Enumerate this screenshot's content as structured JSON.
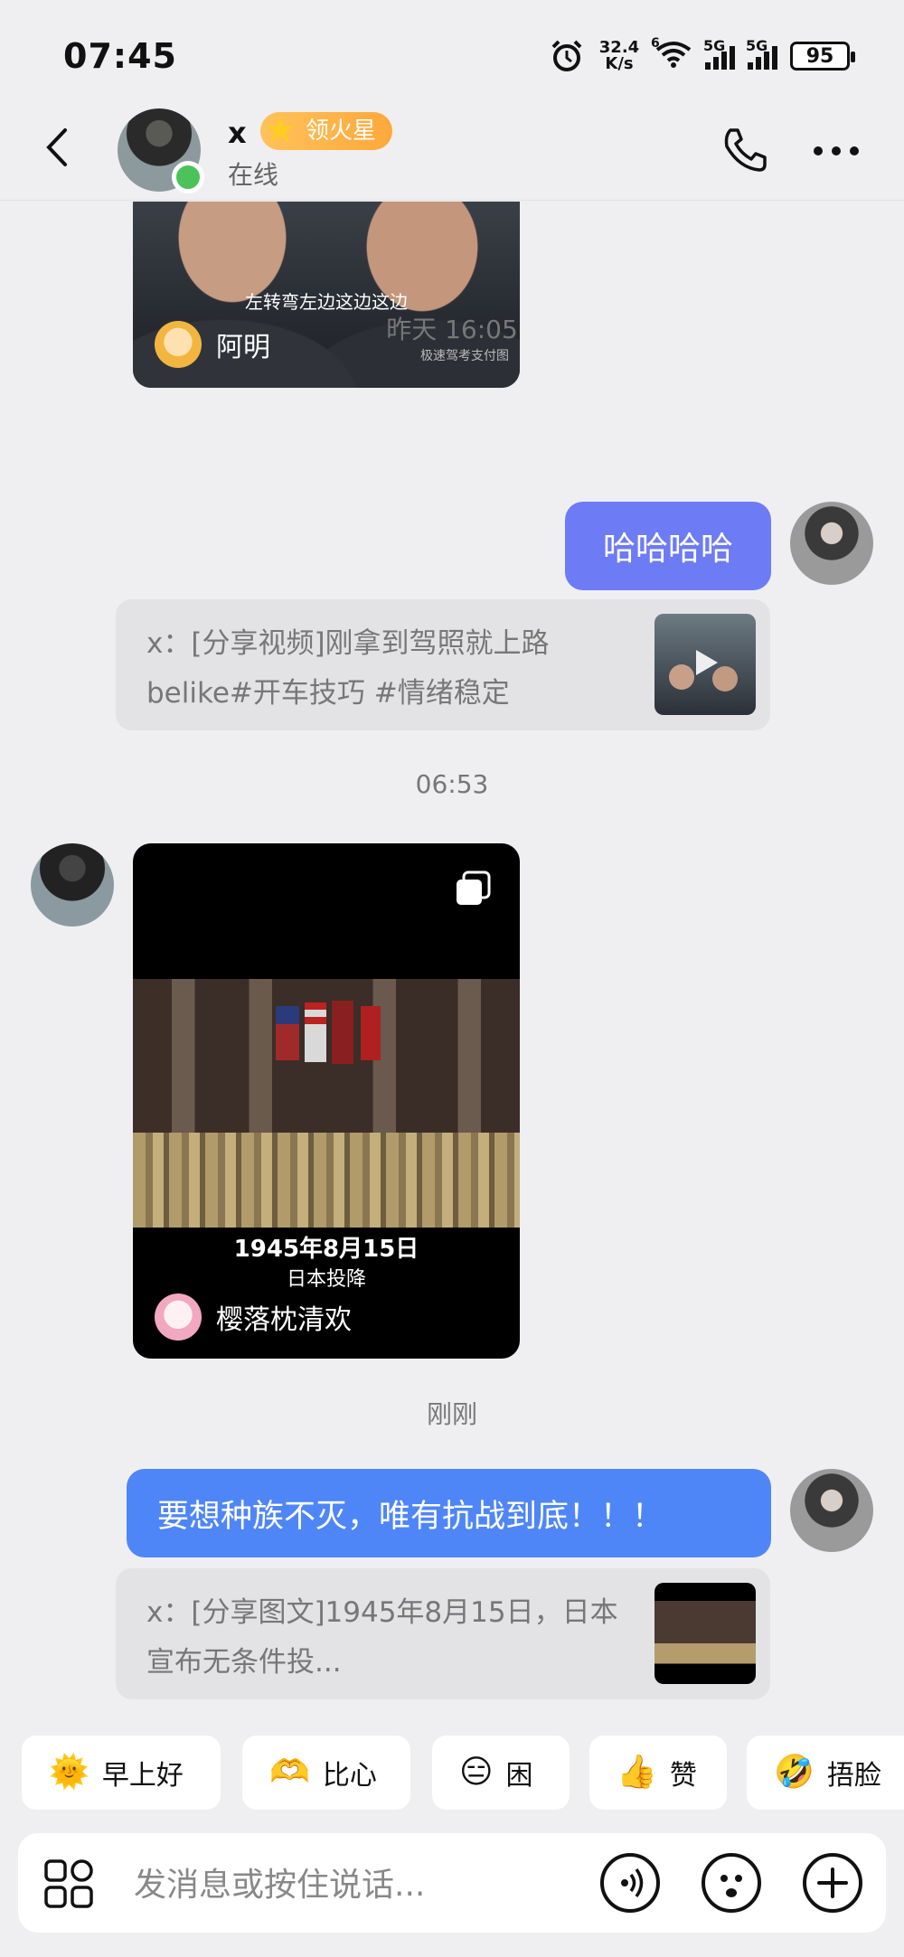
{
  "status_bar": {
    "time": "07:45",
    "net_speed_value": "32.4",
    "net_speed_unit": "K/s",
    "wifi_tag": "6",
    "sig1": "5G",
    "sig2": "5G",
    "battery": "95"
  },
  "header": {
    "contact_name": "x",
    "badge_label": "领火星",
    "status": "在线"
  },
  "messages": {
    "top_card_subtitle": "左转弯左边这边这边",
    "top_card_watermark": "极速驾考支付图",
    "top_card_user": "阿明",
    "ts1": "昨天 16:05",
    "my_msg1": "哈哈哈哈",
    "quote1_line1": "x：[分享视频]刚拿到驾照就上路",
    "quote1_line2": "belike#开车技巧 #情绪稳定",
    "ts2": "06:53",
    "big_card_date": "1945年8月15日",
    "big_card_sub": "日本投降",
    "big_card_user": "樱落枕清欢",
    "ts3": "刚刚",
    "my_msg2": "要想种族不灭，唯有抗战到底！！！",
    "quote2_line1": "x：[分享图文]1945年8月15日，日本",
    "quote2_line2": "宣布无条件投..."
  },
  "quick_replies": [
    {
      "emoji": "🌞",
      "label": "早上好"
    },
    {
      "emoji": "🫶",
      "label": "比心"
    },
    {
      "emoji": "😑",
      "label": "困"
    },
    {
      "emoji": "👍",
      "label": "赞"
    },
    {
      "emoji": "🤣",
      "label": "捂脸"
    }
  ],
  "input": {
    "placeholder": "发消息或按住说话..."
  },
  "colors": {
    "bg": "#efeff1",
    "my_bubble": "#4f86f7",
    "my_bubble_alt": "#6d7bf5",
    "online": "#4cc25a",
    "badge": "#ffb347"
  }
}
